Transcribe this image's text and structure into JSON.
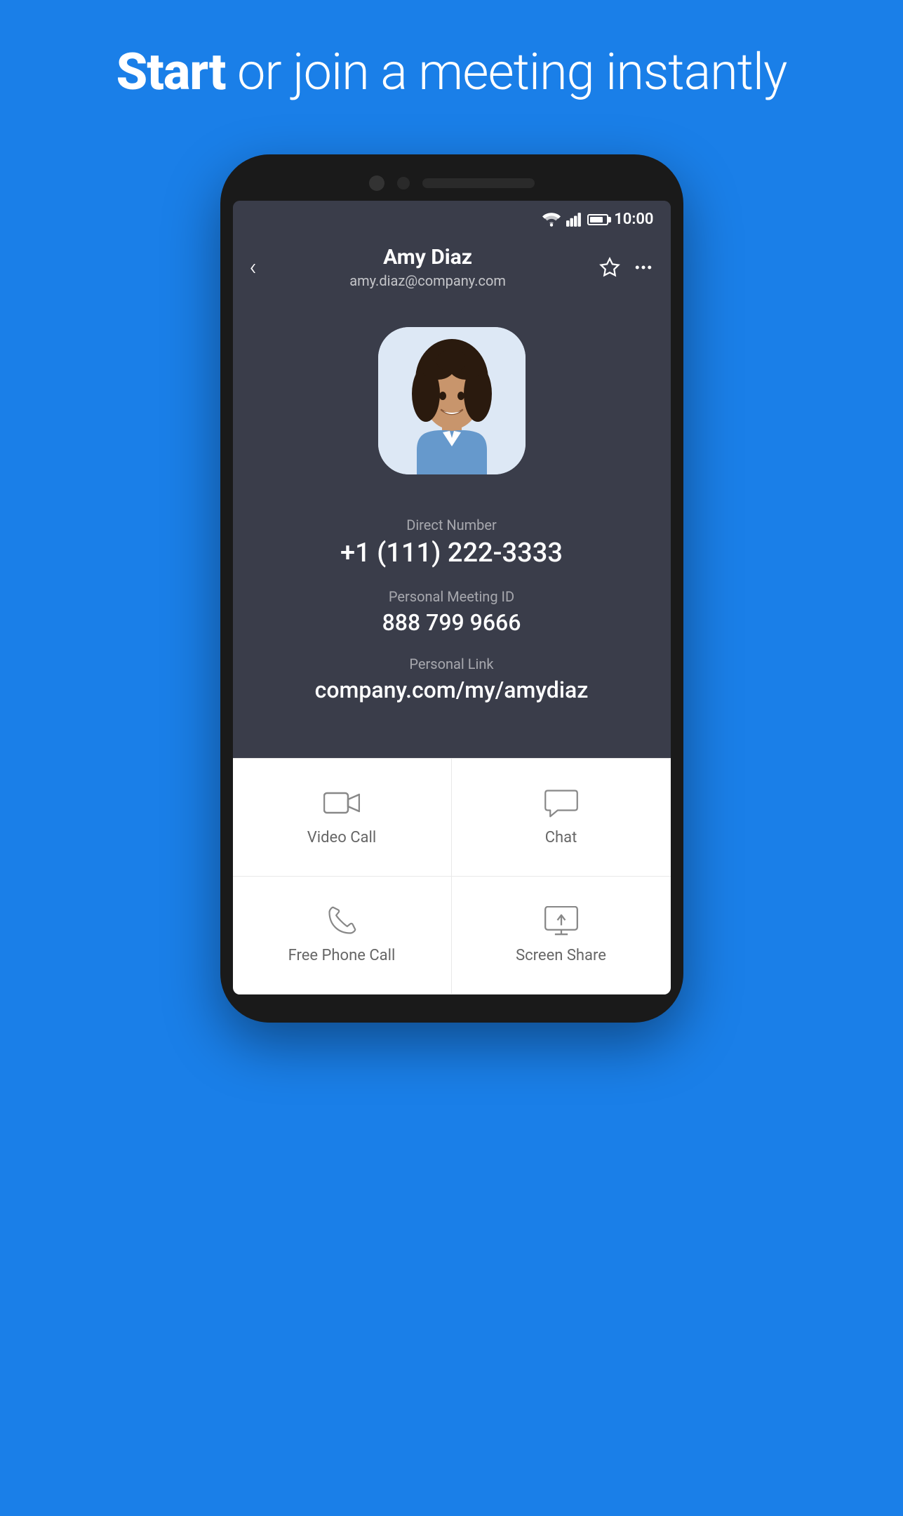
{
  "header": {
    "title_bold": "Start",
    "title_rest": " or join a meeting instantly"
  },
  "status_bar": {
    "time": "10:00"
  },
  "contact": {
    "name": "Amy Diaz",
    "email": "amy.diaz@company.com",
    "direct_number_label": "Direct Number",
    "direct_number": "+1 (111) 222-3333",
    "meeting_id_label": "Personal Meeting ID",
    "meeting_id": "888 799 9666",
    "personal_link_label": "Personal Link",
    "personal_link": "company.com/my/amydiaz"
  },
  "actions": [
    {
      "id": "video-call",
      "label": "Video Call",
      "icon": "video-camera-icon"
    },
    {
      "id": "chat",
      "label": "Chat",
      "icon": "chat-icon"
    },
    {
      "id": "free-phone-call",
      "label": "Free Phone Call",
      "icon": "phone-icon"
    },
    {
      "id": "screen-share",
      "label": "Screen Share",
      "icon": "screen-share-icon"
    }
  ],
  "nav": {
    "back_label": "‹",
    "star_icon": "star-icon",
    "more_icon": "more-icon"
  }
}
